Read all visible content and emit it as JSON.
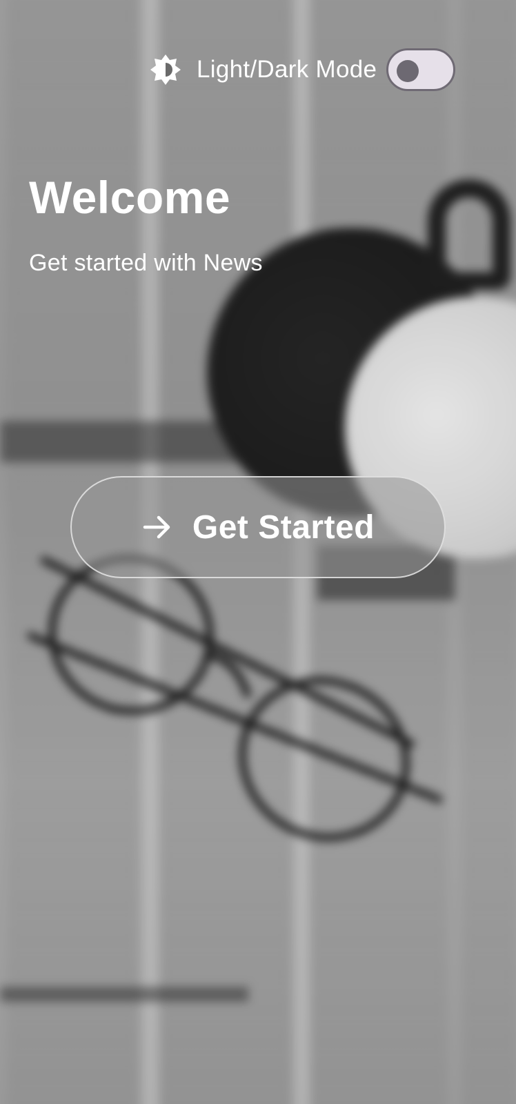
{
  "theme_toggle": {
    "icon": "brightness-icon",
    "label": "Light/Dark Mode",
    "state": "off"
  },
  "welcome": {
    "title": "Welcome",
    "subtitle": "Get started with News"
  },
  "cta": {
    "icon": "arrow-right-icon",
    "label": "Get Started"
  },
  "colors": {
    "text": "#ffffff",
    "toggle_track": "#e6e0e9",
    "toggle_thumb": "#6d6972"
  }
}
